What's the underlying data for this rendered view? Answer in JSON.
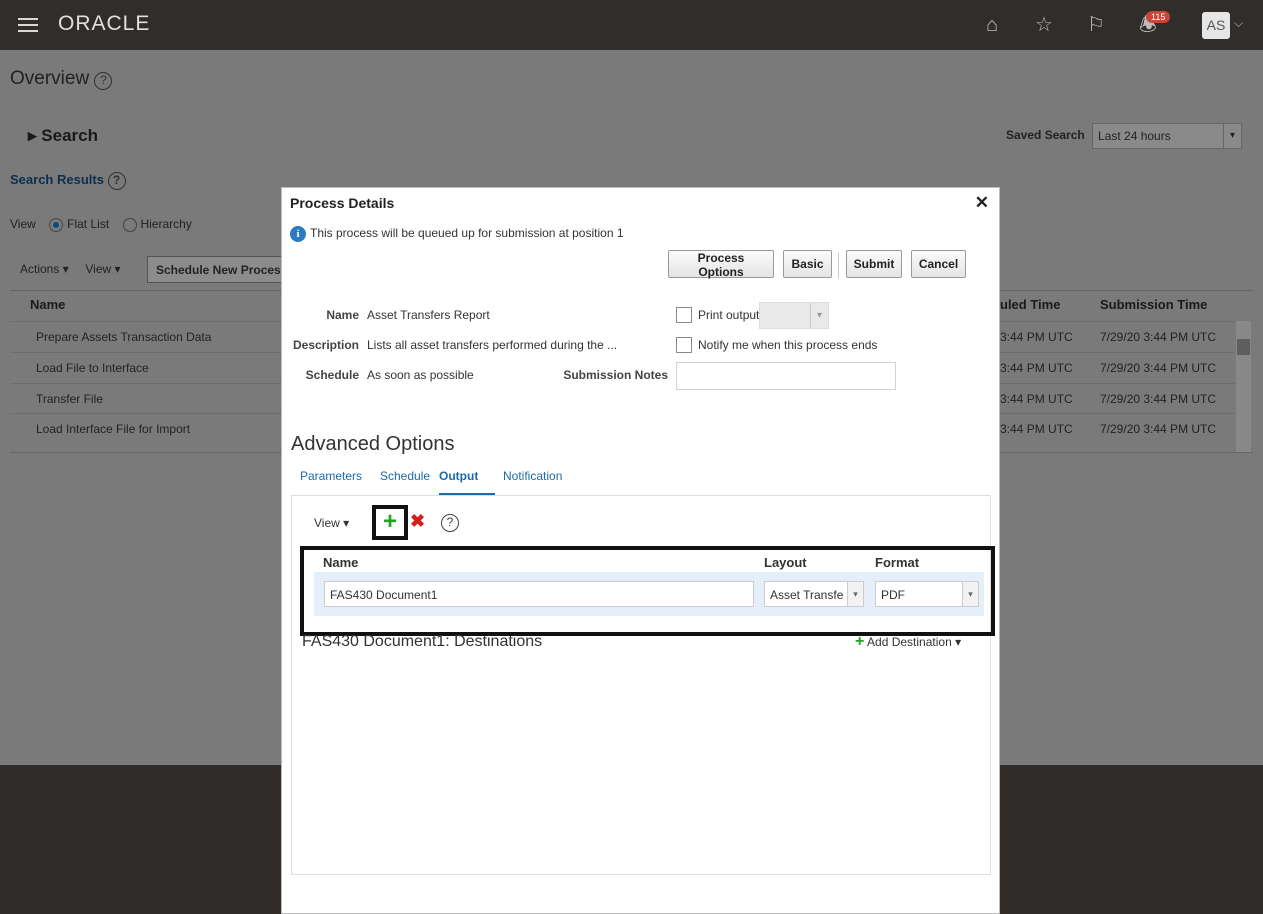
{
  "header": {
    "logo": "ORACLE",
    "notification_count": "115",
    "avatar_initials": "AS"
  },
  "page": {
    "title": "Overview",
    "search_label": "Search",
    "saved_search_label": "Saved Search",
    "saved_search_value": "Last 24 hours",
    "search_results_label": "Search Results",
    "view_label": "View",
    "view_options": [
      "Flat List",
      "Hierarchy"
    ],
    "actions_label": "Actions",
    "view_menu_label": "View",
    "schedule_button": "Schedule New Process",
    "columns": [
      "Name",
      "uled Time",
      "Submission Time"
    ],
    "rows": [
      {
        "name": "Prepare Assets Transaction Data",
        "scheduled": "3:44 PM UTC",
        "submitted": "7/29/20 3:44 PM UTC"
      },
      {
        "name": "Load File to Interface",
        "scheduled": "3:44 PM UTC",
        "submitted": "7/29/20 3:44 PM UTC"
      },
      {
        "name": "Transfer File",
        "scheduled": "3:44 PM UTC",
        "submitted": "7/29/20 3:44 PM UTC"
      },
      {
        "name": "Load Interface File for Import",
        "scheduled": "3:44 PM UTC",
        "submitted": "7/29/20 3:44 PM UTC"
      }
    ]
  },
  "dialog": {
    "title": "Process Details",
    "info_message": "This process will be queued up for submission at position 1",
    "buttons": {
      "process_options": "Process Options",
      "basic": "Basic",
      "submit": "Submit",
      "cancel": "Cancel"
    },
    "fields": {
      "name_label": "Name",
      "name_value": "Asset Transfers Report",
      "description_label": "Description",
      "description_value": "Lists all asset transfers performed during the ...",
      "schedule_label": "Schedule",
      "schedule_value": "As soon as possible",
      "submission_notes_label": "Submission Notes",
      "print_output_label": "Print output",
      "notify_label": "Notify me when this process ends"
    },
    "advanced_title": "Advanced Options",
    "tabs": [
      "Parameters",
      "Schedule",
      "Output",
      "Notification"
    ],
    "active_tab": "Output",
    "output": {
      "view_label": "View",
      "columns": {
        "name": "Name",
        "layout": "Layout",
        "format": "Format"
      },
      "row": {
        "name": "FAS430 Document1",
        "layout": "Asset Transfe",
        "format": "PDF"
      },
      "destinations_title": "FAS430 Document1: Destinations",
      "add_destination": "Add Destination"
    }
  }
}
